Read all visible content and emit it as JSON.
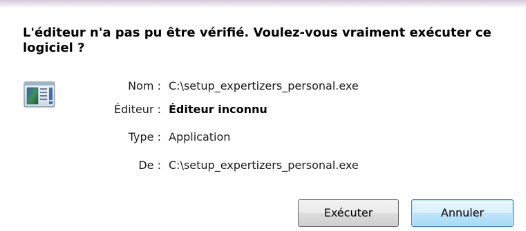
{
  "dialog": {
    "title": "L'éditeur n'a pas pu être vérifié. Voulez-vous vraiment exécuter ce logiciel ?",
    "icon": "application-window-icon"
  },
  "details": {
    "name_label": "Nom :",
    "name_value": "C:\\setup_expertizers_personal.exe",
    "publisher_label": "Éditeur :",
    "publisher_value": "Éditeur inconnu",
    "type_label": "Type :",
    "type_value": "Application",
    "from_label": "De :",
    "from_value": "C:\\setup_expertizers_personal.exe"
  },
  "buttons": {
    "run_label": "Exécuter",
    "cancel_label": "Annuler"
  },
  "colors": {
    "default_button_border": "#3c7fb1",
    "default_button_fill": "#bee6fd",
    "button_border": "#707070"
  }
}
